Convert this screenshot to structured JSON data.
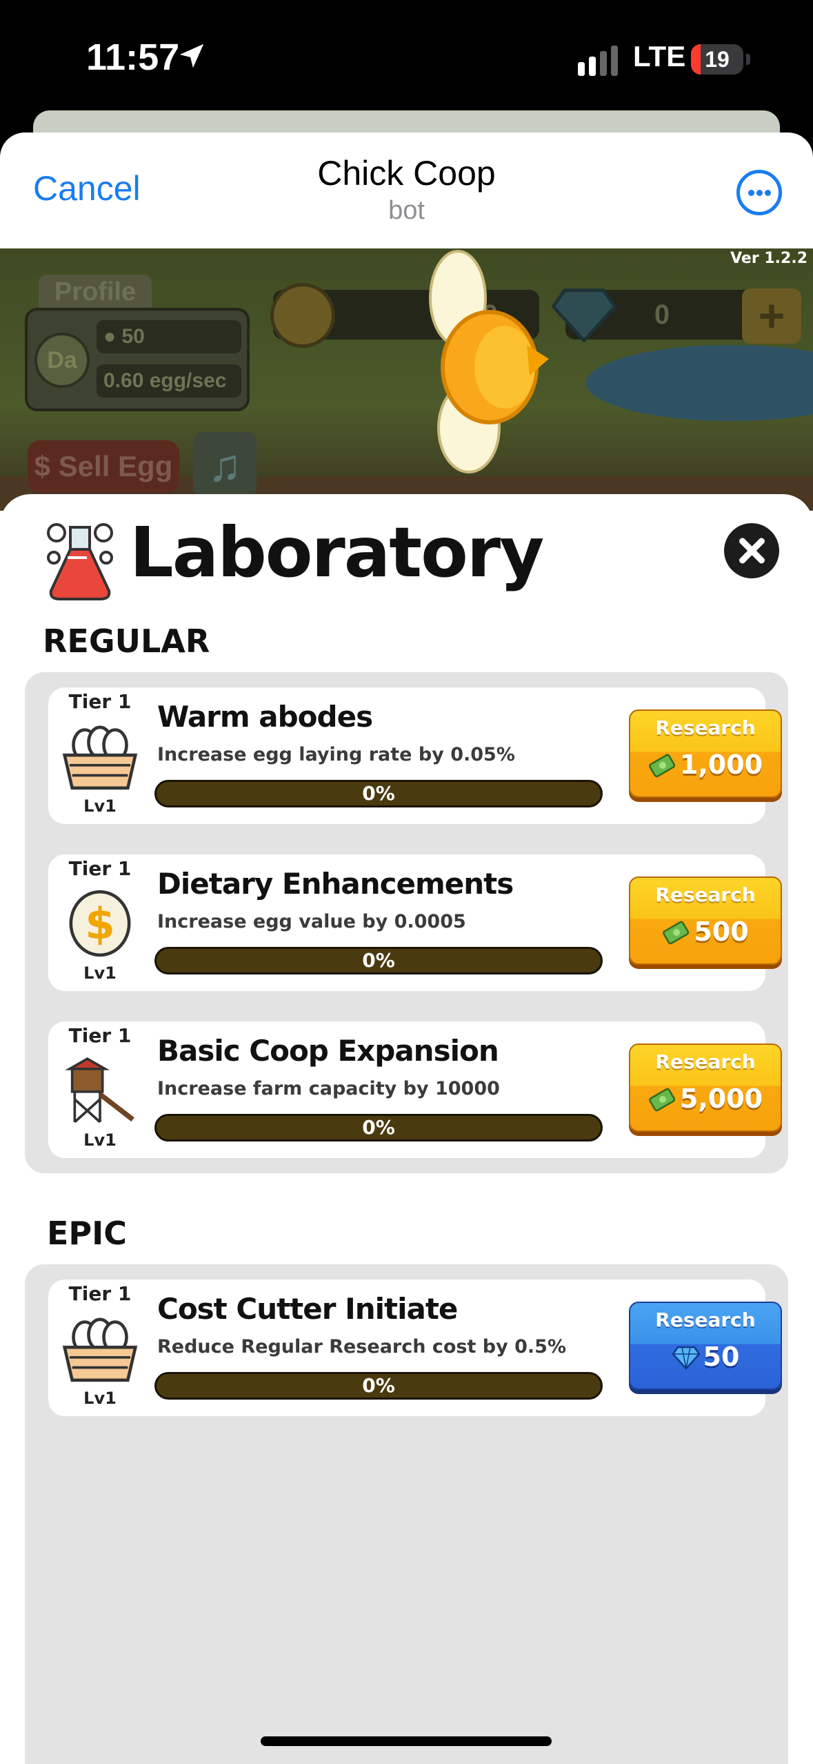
{
  "status_bar": {
    "time": "11:57",
    "network": "LTE",
    "battery": "19",
    "battery_level": 0.19
  },
  "header": {
    "cancel_label": "Cancel",
    "title": "Chick Coop",
    "subtitle": "bot",
    "more_icon": "ellipsis-circle-icon"
  },
  "game": {
    "version": "Ver 1.2.2",
    "profile_tab": "Profile",
    "avatar": "Da",
    "eggs": "50",
    "rate": "0.60 egg/sec",
    "cash": "50",
    "gems": "0",
    "plus_label": "+",
    "sell_label": "$ Sell Egg",
    "music_icon": "♫"
  },
  "lab": {
    "title": "Laboratory",
    "close_icon": "close-icon",
    "sections": [
      {
        "title": "REGULAR",
        "items": [
          {
            "tier": "Tier 1",
            "level": "Lv1",
            "icon": "egg-basket-icon",
            "name": "Warm abodes",
            "description": "Increase egg laying rate by 0.05%",
            "progress_label": "0%",
            "progress": 0,
            "button_label": "Research",
            "currency": "cash",
            "cost": "1,000"
          },
          {
            "tier": "Tier 1",
            "level": "Lv1",
            "icon": "gold-coin-icon",
            "name": "Dietary Enhancements",
            "description": "Increase egg value by 0.0005",
            "progress_label": "0%",
            "progress": 0,
            "button_label": "Research",
            "currency": "cash",
            "cost": "500"
          },
          {
            "tier": "Tier 1",
            "level": "Lv1",
            "icon": "coop-tower-icon",
            "name": "Basic Coop Expansion",
            "description": "Increase farm capacity by 10000",
            "progress_label": "0%",
            "progress": 0,
            "button_label": "Research",
            "currency": "cash",
            "cost": "5,000"
          }
        ]
      },
      {
        "title": "EPIC",
        "items": [
          {
            "tier": "Tier 1",
            "level": "Lv1",
            "icon": "egg-basket-icon",
            "name": "Cost Cutter Initiate",
            "description": "Reduce Regular Research cost by 0.5%",
            "progress_label": "0%",
            "progress": 0,
            "button_label": "Research",
            "currency": "gem",
            "cost": "50"
          }
        ]
      }
    ]
  },
  "colors": {
    "accent": "#1a7cf0",
    "gold_button": "#fbc418",
    "blue_button": "#2f6cde",
    "progress_track": "#4a3a0f"
  }
}
